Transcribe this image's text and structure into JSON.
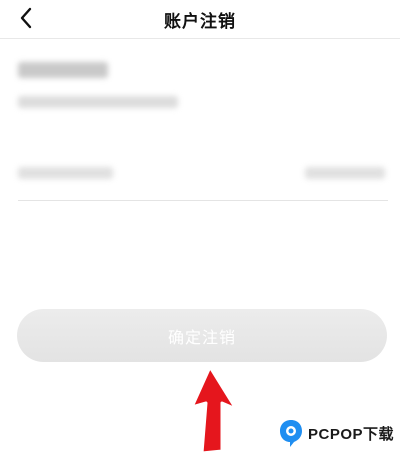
{
  "header": {
    "title": "账户注销",
    "back_icon": "chevron-left-icon"
  },
  "actions": {
    "confirm_label": "确定注销"
  },
  "watermark": {
    "text": "PCPOP下载",
    "logo_icon": "pcpop-logo-icon"
  },
  "colors": {
    "arrow": "#e5161d",
    "watermark_logo": "#1f8ef1",
    "button_bg": "#e6e6e6"
  }
}
